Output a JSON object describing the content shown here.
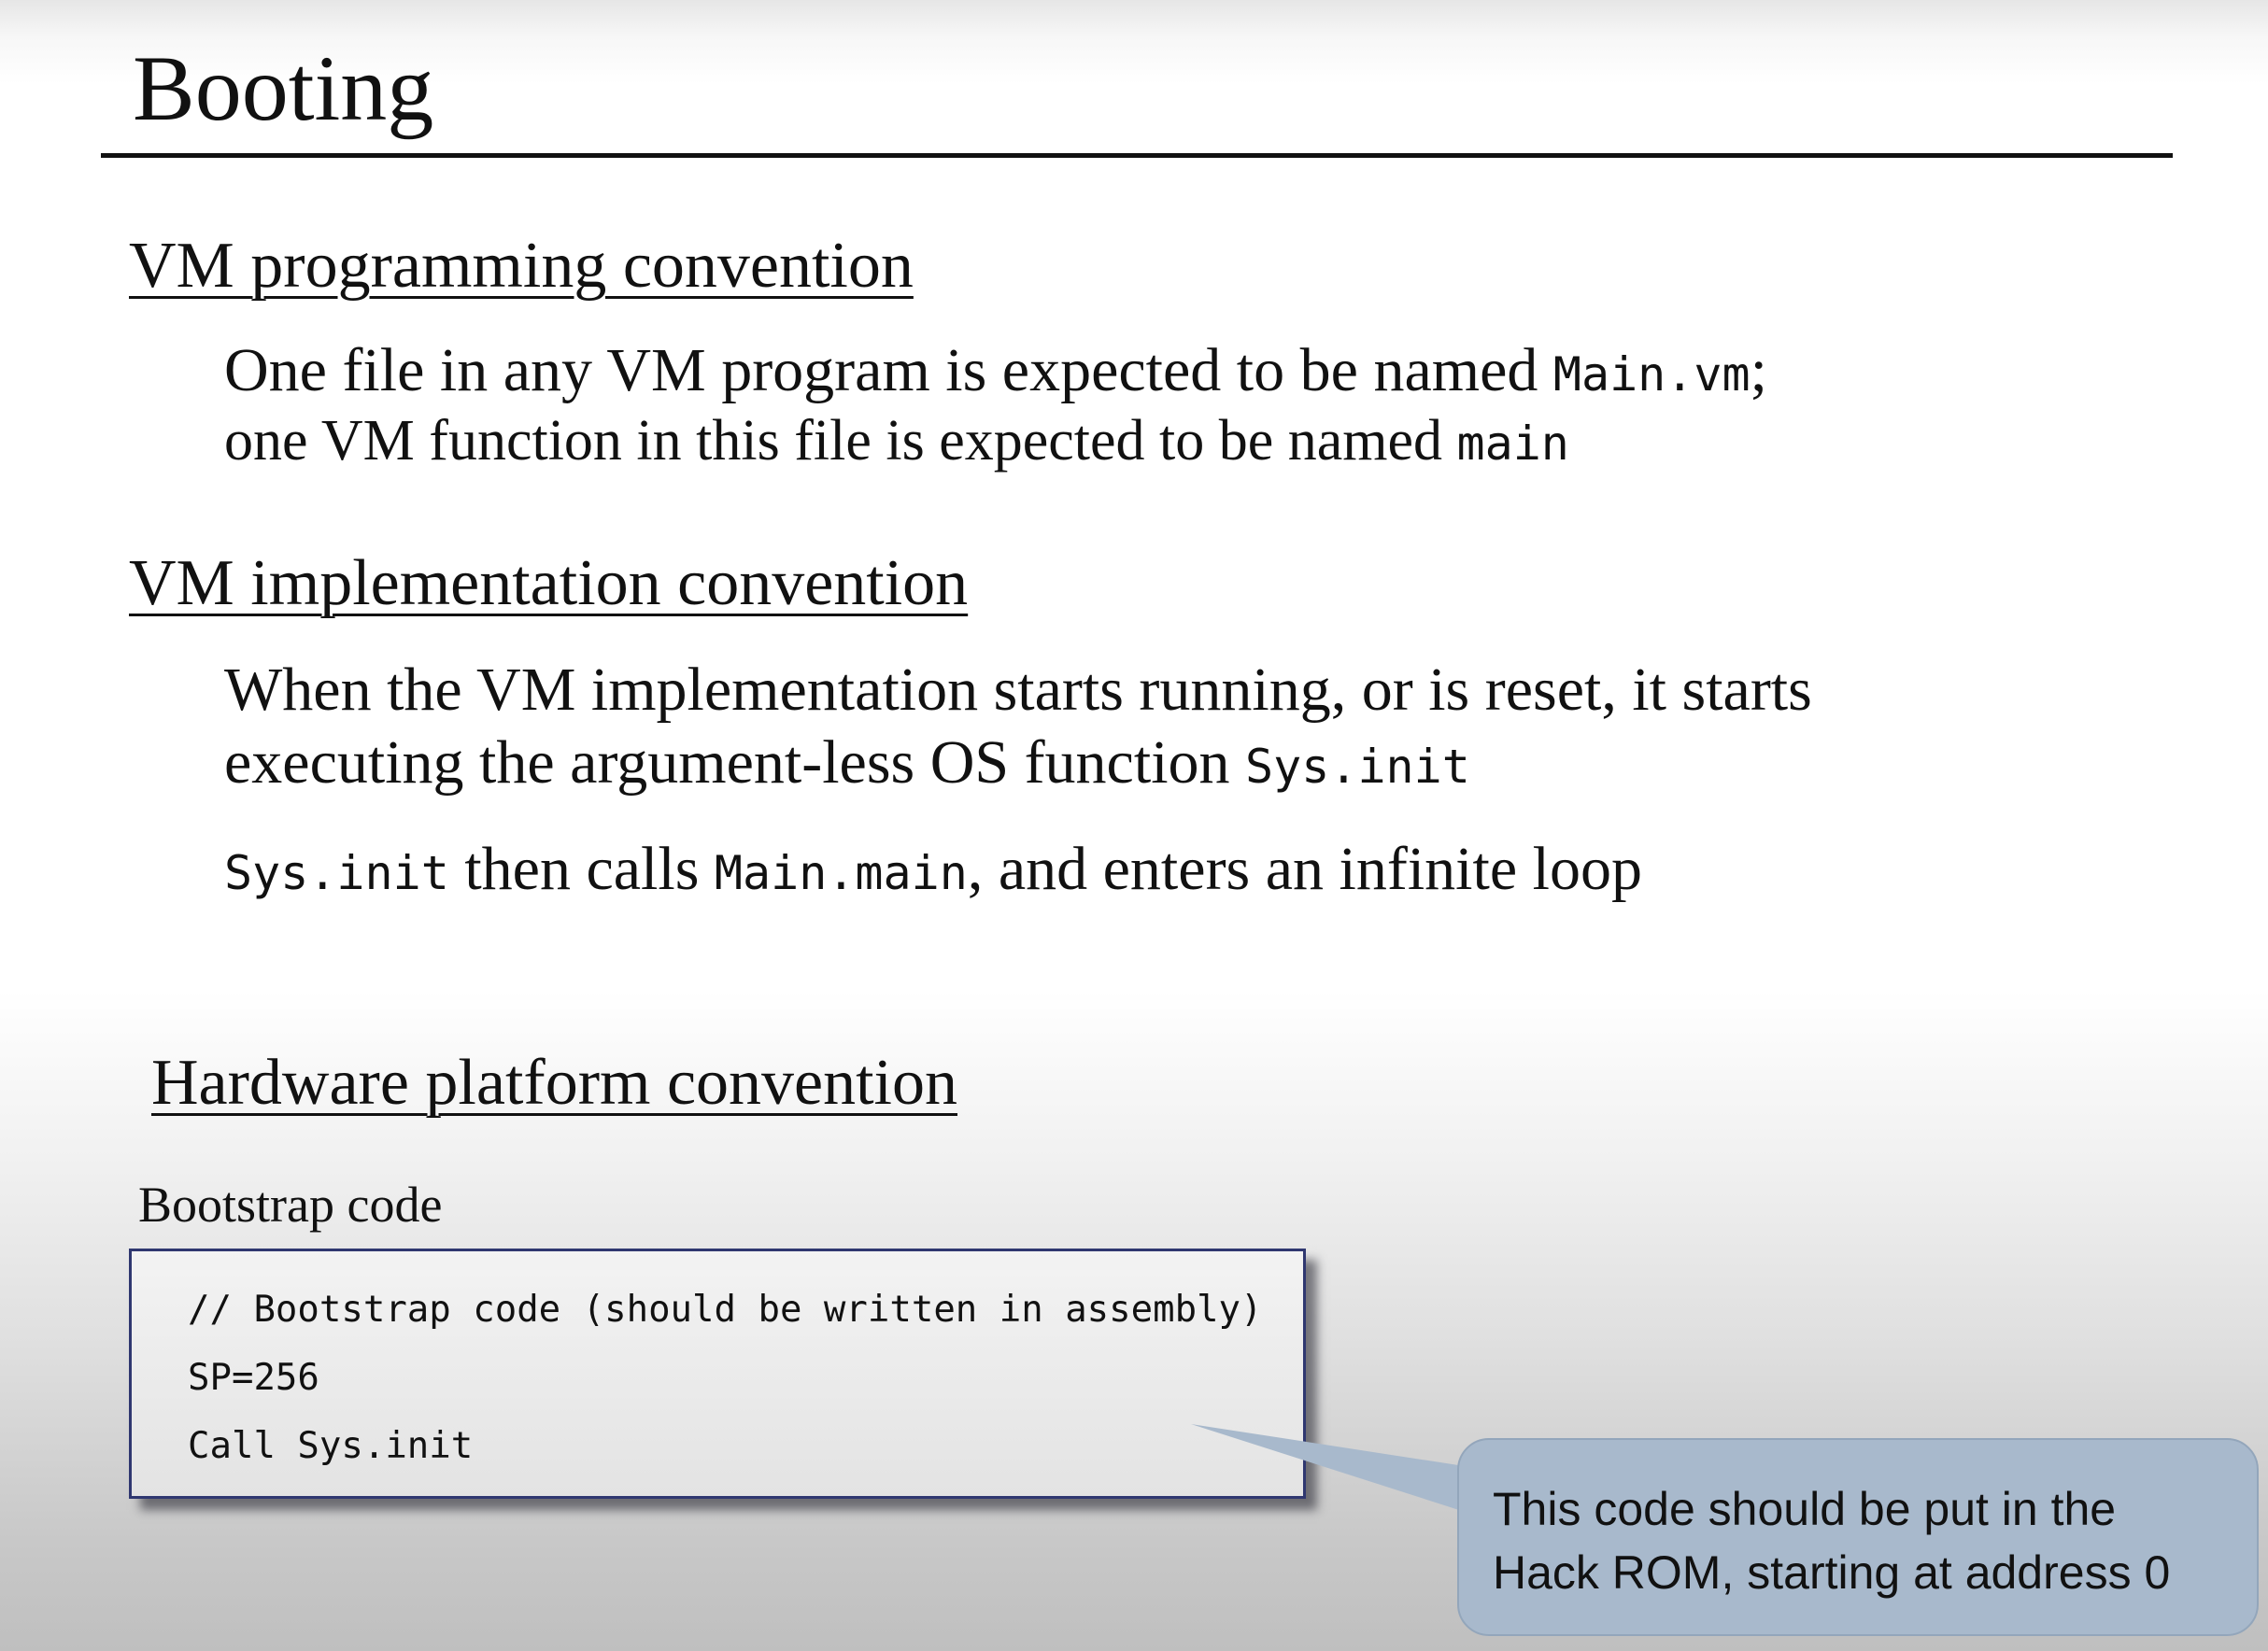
{
  "slide": {
    "title": "Booting",
    "sections": {
      "vm_programming": {
        "heading": "VM programming convention",
        "line1_text": "One file in any VM program is expected to be named ",
        "line1_code": "Main.vm",
        "line1_end": ";",
        "line2_text": "one VM function in this file is expected to be named ",
        "line2_code": "main"
      },
      "vm_implementation": {
        "heading": "VM implementation convention",
        "para1_line1": "When the VM implementation starts running, or is reset, it starts",
        "para1_line2_text": "executing the argument-less OS function ",
        "para1_line2_code": "Sys.init",
        "para2_code1": "Sys.init",
        "para2_text1": " then calls ",
        "para2_code2": "Main.main",
        "para2_text2": ", and enters an infinite loop"
      },
      "hardware_platform": {
        "heading": "Hardware platform convention",
        "bootstrap_label": "Bootstrap code",
        "code_lines": [
          "// Bootstrap code (should be written in assembly)",
          "SP=256",
          "Call Sys.init"
        ],
        "callout_lines": [
          "This code should be put in the",
          "Hack ROM, starting at address 0"
        ]
      }
    }
  },
  "colors": {
    "text": "#111111",
    "code_box_border": "#2f3770",
    "callout_fill": "#a8b9cc"
  }
}
